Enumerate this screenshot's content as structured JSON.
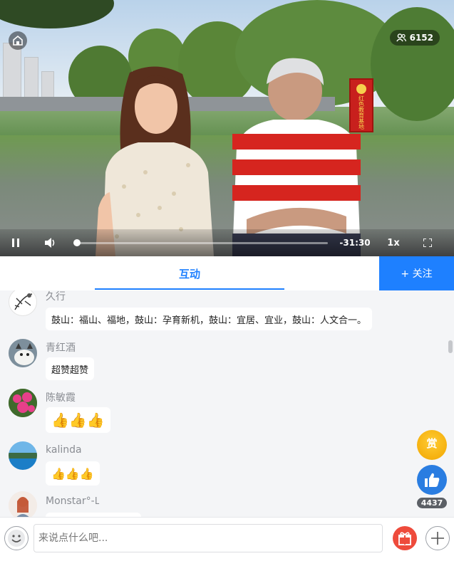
{
  "video": {
    "viewer_count": "6152",
    "time_remaining": "-31:30",
    "playback_speed": "1x",
    "progress_fraction": 0.0,
    "play_state_icon": "pause-icon",
    "banner_text": "红色教育基地"
  },
  "tabs": {
    "active_label": "互动",
    "follow_label": "+ 关注"
  },
  "comments": [
    {
      "user": "久行",
      "text": "鼓山：福山、福地，鼓山：孕育新机，鼓山：宜居、宜业，鼓山：人文合一。",
      "avatar": "ink-painting-avatar"
    },
    {
      "user": "青红酒",
      "text": "超赞超赞",
      "avatar": "cat-avatar"
    },
    {
      "user": "陈敏霞",
      "text": "👍👍👍",
      "avatar": "flower-avatar"
    },
    {
      "user": "kalinda",
      "text": "👍👍👍",
      "avatar": "lake-avatar"
    },
    {
      "user": "Monstar°-𑀉",
      "text": "",
      "avatar": "girl-avatar"
    }
  ],
  "side_actions": {
    "reward_label": "赏",
    "like_count": "4437"
  },
  "input": {
    "placeholder": "来说点什么吧..."
  },
  "colors": {
    "accent": "#1e80ff",
    "gift": "#ee4b3c",
    "reward": "#f1a500"
  }
}
